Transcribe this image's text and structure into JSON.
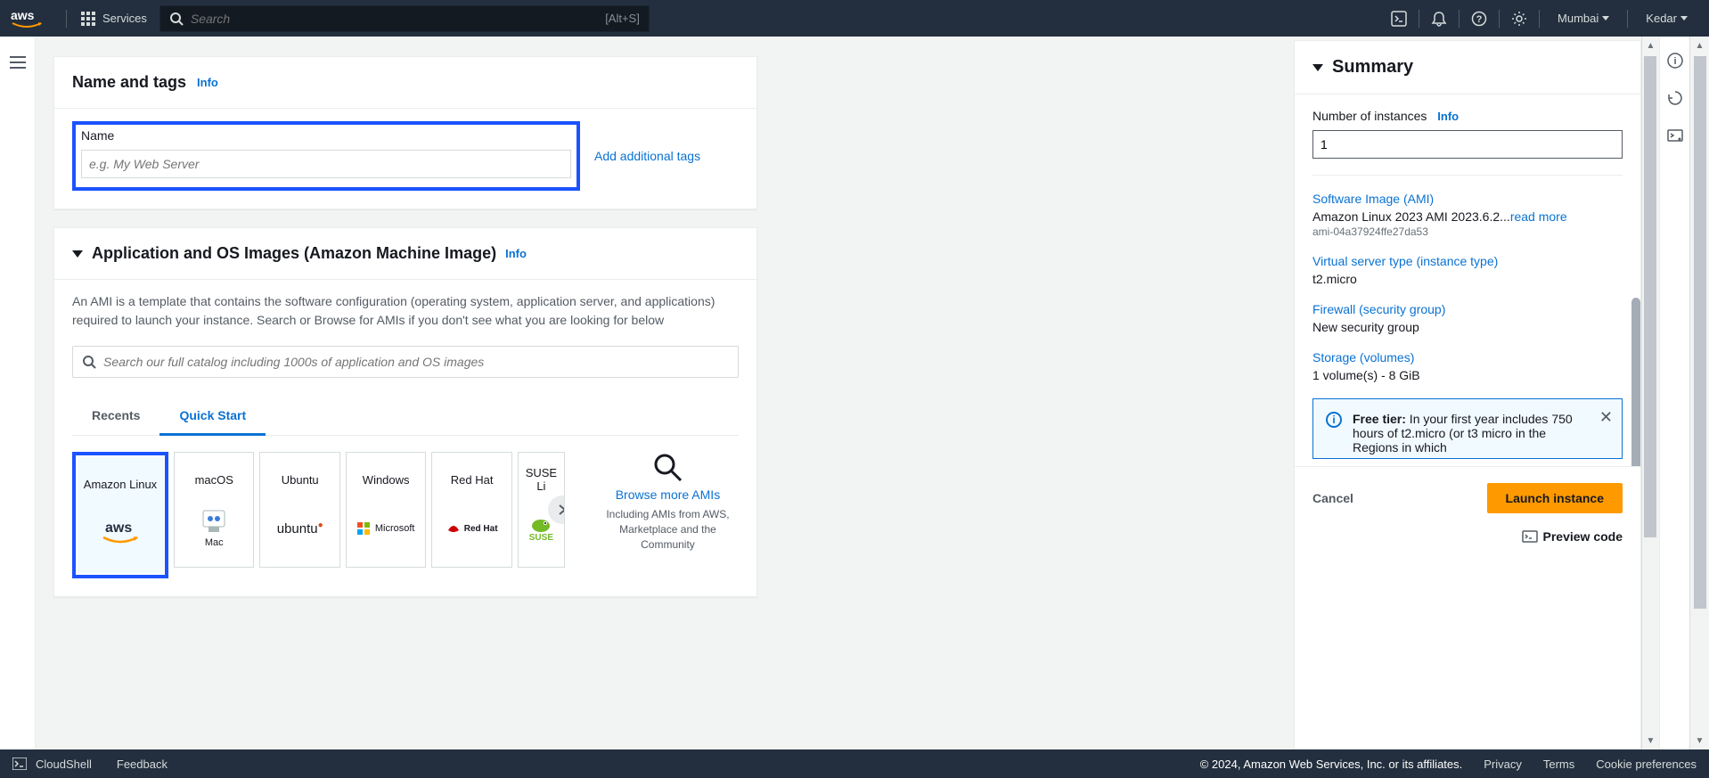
{
  "header": {
    "services_label": "Services",
    "search_placeholder": "Search",
    "search_shortcut": "[Alt+S]",
    "region": "Mumbai",
    "user": "Kedar"
  },
  "name_tags": {
    "title": "Name and tags",
    "info": "Info",
    "name_label": "Name",
    "name_placeholder": "e.g. My Web Server",
    "add_tags": "Add additional tags"
  },
  "ami": {
    "title": "Application and OS Images (Amazon Machine Image)",
    "info": "Info",
    "description": "An AMI is a template that contains the software configuration (operating system, application server, and applications) required to launch your instance. Search or Browse for AMIs if you don't see what you are looking for below",
    "search_placeholder": "Search our full catalog including 1000s of application and OS images",
    "tabs": {
      "recents": "Recents",
      "quick_start": "Quick Start"
    },
    "os_tiles": [
      {
        "name": "Amazon Linux",
        "brand": "aws"
      },
      {
        "name": "macOS",
        "brand": "Mac"
      },
      {
        "name": "Ubuntu",
        "brand": "ubuntu"
      },
      {
        "name": "Windows",
        "brand": "Microsoft"
      },
      {
        "name": "Red Hat",
        "brand": "RedHat"
      },
      {
        "name": "SUSE Li",
        "brand": "SUSE"
      }
    ],
    "browse_more": "Browse more AMIs",
    "browse_sub": "Including AMIs from AWS, Marketplace and the Community"
  },
  "summary": {
    "title": "Summary",
    "num_label": "Number of instances",
    "num_info": "Info",
    "num_value": "1",
    "ami_link": "Software Image (AMI)",
    "ami_val": "Amazon Linux 2023 AMI 2023.6.2...",
    "read_more": "read more",
    "ami_id": "ami-04a37924ffe27da53",
    "inst_link": "Virtual server type (instance type)",
    "inst_val": "t2.micro",
    "fw_link": "Firewall (security group)",
    "fw_val": "New security group",
    "storage_link": "Storage (volumes)",
    "storage_val": "1 volume(s) - 8 GiB",
    "free_tier_bold": "Free tier:",
    "free_tier_text": " In your first year includes 750 hours of t2.micro (or t3 micro in the Regions in which",
    "cancel": "Cancel",
    "launch": "Launch instance",
    "preview": "Preview code"
  },
  "footer": {
    "cloudshell": "CloudShell",
    "feedback": "Feedback",
    "copyright": "© 2024, Amazon Web Services, Inc. or its affiliates.",
    "privacy": "Privacy",
    "terms": "Terms",
    "cookies": "Cookie preferences"
  }
}
